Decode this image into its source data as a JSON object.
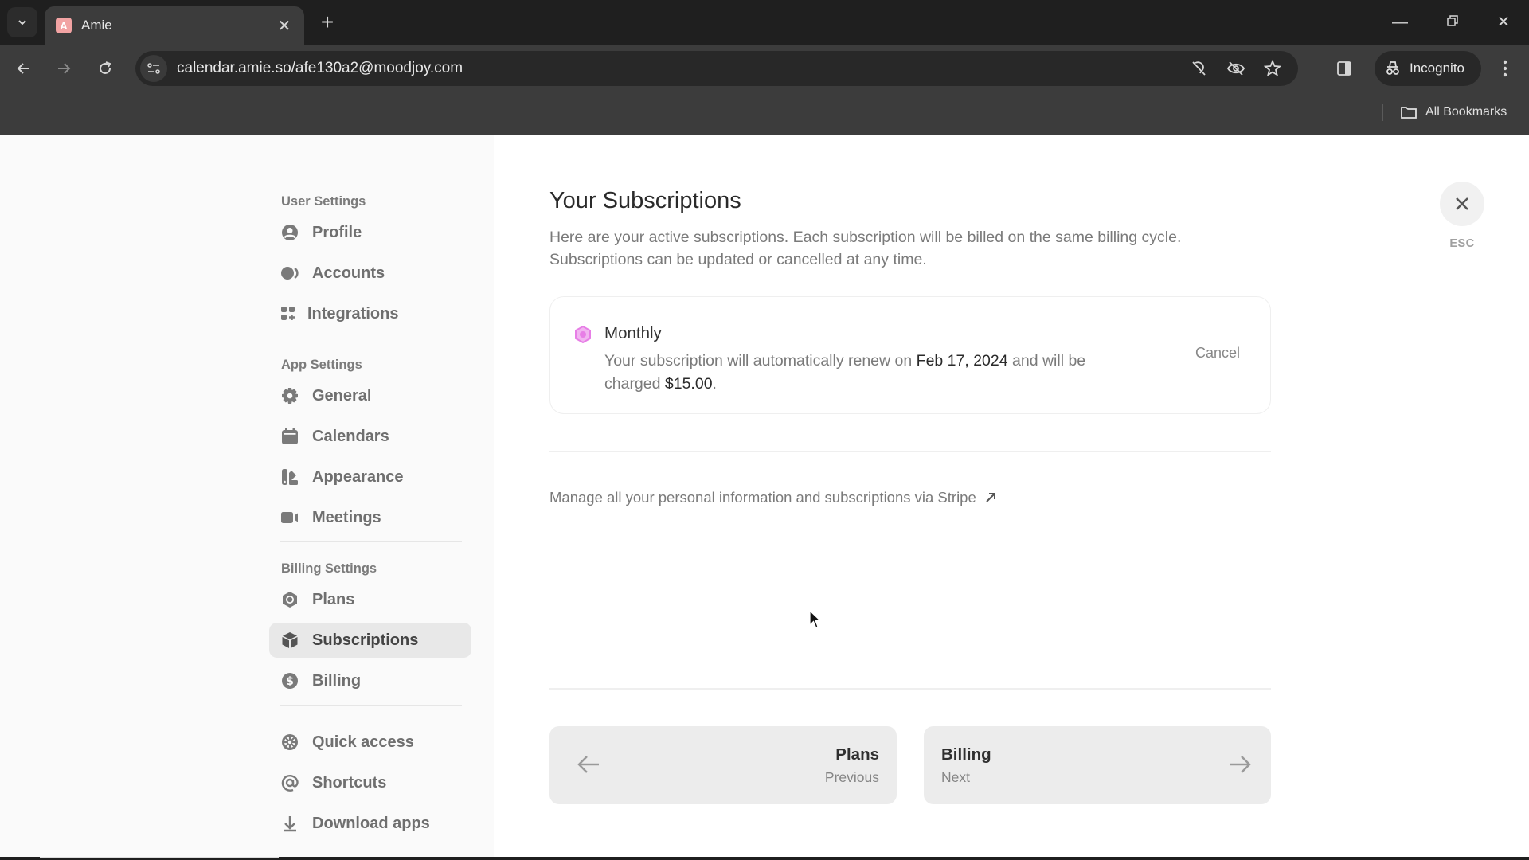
{
  "browser": {
    "tab_title": "Amie",
    "tab_favicon_letter": "A",
    "url": "calendar.amie.so/afe130a2@moodjoy.com",
    "profile_label": "Incognito",
    "bookmarks_label": "All Bookmarks",
    "icons": [
      "tab-search-icon",
      "close-icon",
      "new-tab-icon",
      "minimize-icon",
      "restore-icon",
      "window-close-icon",
      "back-icon",
      "forward-icon",
      "reload-icon",
      "site-settings-icon",
      "eye-off-icon",
      "tracking-off-icon",
      "star-icon",
      "side-panel-icon",
      "incognito-icon",
      "kebab-menu-icon",
      "folder-icon"
    ]
  },
  "sidebar": {
    "groups": [
      {
        "heading": "User Settings",
        "items": [
          {
            "label": "Profile",
            "icon": "user-circle-icon"
          },
          {
            "label": "Accounts",
            "icon": "accounts-icon"
          },
          {
            "label": "Integrations",
            "icon": "grid-plus-icon"
          }
        ]
      },
      {
        "heading": "App Settings",
        "items": [
          {
            "label": "General",
            "icon": "gear-icon"
          },
          {
            "label": "Calendars",
            "icon": "calendar-icon"
          },
          {
            "label": "Appearance",
            "icon": "palette-icon"
          },
          {
            "label": "Meetings",
            "icon": "video-icon"
          }
        ]
      },
      {
        "heading": "Billing Settings",
        "items": [
          {
            "label": "Plans",
            "icon": "hexagon-icon"
          },
          {
            "label": "Subscriptions",
            "icon": "cube-icon",
            "active": true
          },
          {
            "label": "Billing",
            "icon": "dollar-icon"
          }
        ]
      },
      {
        "heading": "",
        "items": [
          {
            "label": "Quick access",
            "icon": "wheel-icon"
          },
          {
            "label": "Shortcuts",
            "icon": "at-icon"
          },
          {
            "label": "Download apps",
            "icon": "download-icon"
          }
        ]
      }
    ]
  },
  "main": {
    "title": "Your Subscriptions",
    "description_line1": "Here are your active subscriptions. Each subscription will be billed on the same billing cycle.",
    "description_line2": "Subscriptions can be updated or cancelled at any time.",
    "subscription": {
      "name": "Monthly",
      "icon_color": "#e77ee6",
      "renew_prefix": "Your subscription will automatically renew on",
      "renew_date": "Feb 17, 2024",
      "renew_mid": "and will be charged",
      "amount": "$15.00",
      "renew_suffix": ".",
      "cancel_label": "Cancel"
    },
    "stripe_link": "Manage all your personal information and subscriptions via Stripe",
    "pager": {
      "prev_title": "Plans",
      "prev_label": "Previous",
      "next_title": "Billing",
      "next_label": "Next"
    },
    "close_label": "ESC"
  }
}
